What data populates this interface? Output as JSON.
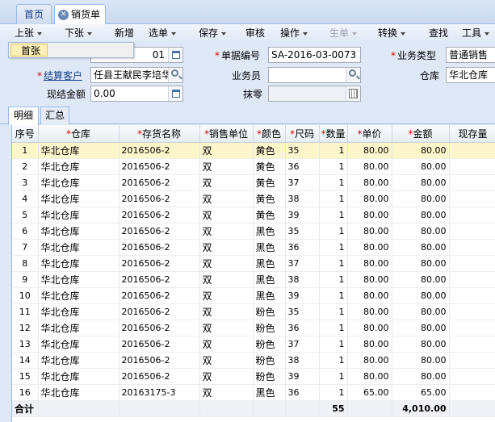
{
  "tabs": [
    {
      "label": "首页"
    },
    {
      "label": "销货单"
    }
  ],
  "toolbar": {
    "items": [
      {
        "label": "上张",
        "dropdown": true
      },
      {
        "label": "下张",
        "dropdown": true
      },
      {
        "label": "新增",
        "dropdown": false
      },
      {
        "label": "选单",
        "dropdown": true
      },
      {
        "label": "保存",
        "dropdown": true
      },
      {
        "label": "审核",
        "dropdown": false
      },
      {
        "label": "操作",
        "dropdown": true
      },
      {
        "label": "生单",
        "dropdown": true
      },
      {
        "label": "转换",
        "dropdown": true
      },
      {
        "label": "查找",
        "dropdown": false
      },
      {
        "label": "工具",
        "dropdown": true
      }
    ]
  },
  "dropdown_menu": {
    "items": [
      {
        "label": "首张"
      }
    ]
  },
  "form": {
    "date_partial": "01",
    "doc_no_label": "单据编号",
    "doc_no": "SA-2016-03-0073",
    "biz_type_label": "业务类型",
    "biz_type": "普通销售",
    "customer_label": "结算客户",
    "customer": "任县王献民李培华",
    "salesman_label": "业务员",
    "salesman": "",
    "warehouse_label": "仓库",
    "warehouse": "华北仓库",
    "cash_label": "现结金额",
    "cash": "0.00",
    "discount_label": "抹零",
    "discount": ""
  },
  "subtabs": [
    {
      "label": "明细"
    },
    {
      "label": "汇总"
    }
  ],
  "grid": {
    "columns": [
      {
        "label": "序号",
        "required": false
      },
      {
        "label": "仓库",
        "required": true
      },
      {
        "label": "存货名称",
        "required": true
      },
      {
        "label": "销售单位",
        "required": true
      },
      {
        "label": "颜色",
        "required": true
      },
      {
        "label": "尺码",
        "required": true
      },
      {
        "label": "数量",
        "required": true
      },
      {
        "label": "单价",
        "required": true
      },
      {
        "label": "金额",
        "required": true
      },
      {
        "label": "现存量",
        "required": false
      }
    ],
    "rows": [
      [
        "1",
        "华北仓库",
        "2016506-2",
        "双",
        "黄色",
        "35",
        "1",
        "80.00",
        "80.00",
        ""
      ],
      [
        "2",
        "华北仓库",
        "2016506-2",
        "双",
        "黄色",
        "36",
        "1",
        "80.00",
        "80.00",
        ""
      ],
      [
        "3",
        "华北仓库",
        "2016506-2",
        "双",
        "黄色",
        "37",
        "1",
        "80.00",
        "80.00",
        ""
      ],
      [
        "4",
        "华北仓库",
        "2016506-2",
        "双",
        "黄色",
        "38",
        "1",
        "80.00",
        "80.00",
        ""
      ],
      [
        "5",
        "华北仓库",
        "2016506-2",
        "双",
        "黄色",
        "39",
        "1",
        "80.00",
        "80.00",
        ""
      ],
      [
        "6",
        "华北仓库",
        "2016506-2",
        "双",
        "黑色",
        "35",
        "1",
        "80.00",
        "80.00",
        ""
      ],
      [
        "7",
        "华北仓库",
        "2016506-2",
        "双",
        "黑色",
        "36",
        "1",
        "80.00",
        "80.00",
        ""
      ],
      [
        "8",
        "华北仓库",
        "2016506-2",
        "双",
        "黑色",
        "37",
        "1",
        "80.00",
        "80.00",
        ""
      ],
      [
        "9",
        "华北仓库",
        "2016506-2",
        "双",
        "黑色",
        "38",
        "1",
        "80.00",
        "80.00",
        ""
      ],
      [
        "10",
        "华北仓库",
        "2016506-2",
        "双",
        "黑色",
        "39",
        "1",
        "80.00",
        "80.00",
        ""
      ],
      [
        "11",
        "华北仓库",
        "2016506-2",
        "双",
        "粉色",
        "35",
        "1",
        "80.00",
        "80.00",
        ""
      ],
      [
        "12",
        "华北仓库",
        "2016506-2",
        "双",
        "粉色",
        "36",
        "1",
        "80.00",
        "80.00",
        ""
      ],
      [
        "13",
        "华北仓库",
        "2016506-2",
        "双",
        "粉色",
        "37",
        "1",
        "80.00",
        "80.00",
        ""
      ],
      [
        "14",
        "华北仓库",
        "2016506-2",
        "双",
        "粉色",
        "38",
        "1",
        "80.00",
        "80.00",
        ""
      ],
      [
        "15",
        "华北仓库",
        "2016506-2",
        "双",
        "粉色",
        "39",
        "1",
        "80.00",
        "80.00",
        ""
      ],
      [
        "16",
        "华北仓库",
        "20163175-3",
        "双",
        "黑色",
        "36",
        "1",
        "65.00",
        "65.00",
        ""
      ]
    ],
    "selected_row": 0,
    "total": {
      "label": "合计",
      "quantity": "55",
      "amount": "4,010.00"
    }
  }
}
